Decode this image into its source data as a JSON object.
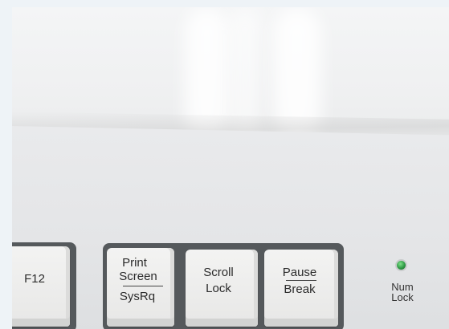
{
  "keys": {
    "f12": "F12",
    "print_screen_top_1": "Print",
    "print_screen_top_2": "Screen",
    "print_screen_bottom": "SysRq",
    "scroll_lock_1": "Scroll",
    "scroll_lock_2": "Lock",
    "pause_top": "Pause",
    "pause_bottom": "Break"
  },
  "indicator": {
    "label_1": "Num",
    "label_2": "Lock",
    "color": "#2f9a45",
    "state": "on"
  }
}
